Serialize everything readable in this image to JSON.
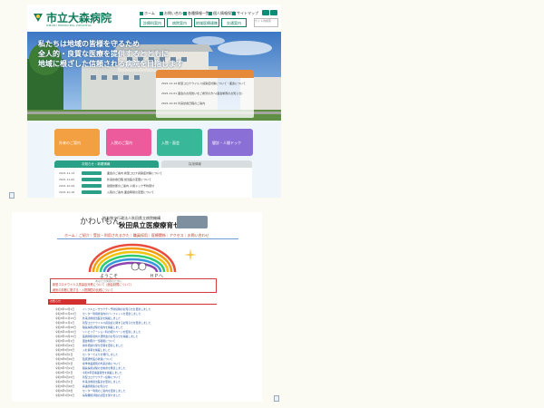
{
  "shot1": {
    "logo_text": "市立大森病院",
    "logo_en": "OMORI MUNICIPAL HOSPITAL",
    "utility_links": [
      "ホーム",
      "お問い合わせ",
      "各種情報一覧",
      "個人情報保護",
      "サイトマップ",
      "ご案内"
    ],
    "nav_items": [
      "診療科案内",
      "病院案内",
      "地域医療連携",
      "交通案内"
    ],
    "search_placeholder": "サイト内検索",
    "hero_copy": [
      "私たちは地域の皆様を守るため",
      "全人的・良質な医療を提供するとともに",
      "地域に根ざした信頼される病院を目指します"
    ],
    "news_lines": [
      "2021.11.14 新型コロナウイルス感染症対策について・面会について",
      "2021.11.01 面会のお見舞いをご希望の方へ(面会制限のお知らせ)",
      "2021.10.29 外来診療日程のご案内"
    ],
    "cards": [
      {
        "label": "外来のご案内",
        "color": "#f2a041"
      },
      {
        "label": "入院のご案内",
        "color": "#ec5b9c"
      },
      {
        "label": "入院・面会",
        "color": "#39b899"
      },
      {
        "label": "健診・人間ドック",
        "color": "#8a6fd6"
      }
    ],
    "tab_active": "お知らせ・新着情報",
    "tab_inactive": "採用情報",
    "info_rows": [
      {
        "date": "2021.11.14",
        "text": "面会のご案内 新型コロナ感染症対策について"
      },
      {
        "date": "2021.11.05",
        "text": "外来診療日程 担当医の変更について"
      },
      {
        "date": "2021.10.29",
        "text": "健康診断のご案内 人間ドック予約受付"
      },
      {
        "date": "2021.10.18",
        "text": "入院のご案内 面会時間の変更について"
      }
    ]
  },
  "shot2": {
    "mascot": "かわいもん",
    "subtitle": "地方独立行政法人秋田県立病院機構",
    "title": "秋田県立医療療育センター",
    "nav": "ホーム｜ご紹介｜受診・利用されるかた｜職員採用｜医療関係｜アクセス｜お問い合わせ",
    "welcome": "ようこそ　　　　　　　ＨＰへ",
    "welcome_sub": "あなたの笑顔のために",
    "notice_lines": [
      "新型コロナウイルス感染症対策について（面会制限について）",
      "病気の診断に関する・入院期間の比較について"
    ],
    "news_header": "お知らせ",
    "news_rows": [
      {
        "date": "令和3年12月1日",
        "text": "インフルエンザワクチン予防接種のお知らせを更新しました"
      },
      {
        "date": "令和3年11月22日",
        "text": "センター利用者案内のパンフレットを更新しました"
      },
      {
        "date": "令和3年11月15日",
        "text": "外来診療担当医表を掲載しました"
      },
      {
        "date": "令和3年11月1日",
        "text": "新型コロナウイルス感染症に関するお知らせを更新しました"
      },
      {
        "date": "令和3年10月28日",
        "text": "職員採用試験の案内を掲載しました"
      },
      {
        "date": "令和3年10月20日",
        "text": "リハビリテーション科の紹介ページを更新しました"
      },
      {
        "date": "令和3年10月15日",
        "text": "医療関係者向け研修会のお知らせを掲載しました"
      },
      {
        "date": "令和3年10月1日",
        "text": "面会制限の一部緩和について"
      },
      {
        "date": "令和3年9月24日",
        "text": "療育相談の受付日程を更新しました"
      },
      {
        "date": "令和3年9月15日",
        "text": "入札情報を掲載しました"
      },
      {
        "date": "令和3年9月1日",
        "text": "センターだよりを発行しました"
      },
      {
        "date": "令和3年8月20日",
        "text": "臨床研修医の募集について"
      },
      {
        "date": "令和3年8月2日",
        "text": "夏季休業期間の外来診療について"
      },
      {
        "date": "令和3年7月21日",
        "text": "職員採用試験の合格者を発表しました"
      },
      {
        "date": "令和3年7月1日",
        "text": "令和2年度事業報告を掲載しました"
      },
      {
        "date": "令和3年6月15日",
        "text": "新型コロナワクチン接種について"
      },
      {
        "date": "令和3年6月1日",
        "text": "外来診療担当医表を更新しました"
      },
      {
        "date": "令和3年5月20日",
        "text": "看護師募集のお知らせ"
      },
      {
        "date": "令和3年5月6日",
        "text": "センター利用のご案内を更新しました"
      },
      {
        "date": "令和3年4月15日",
        "text": "病院機能評価の認定を受けました"
      }
    ]
  }
}
